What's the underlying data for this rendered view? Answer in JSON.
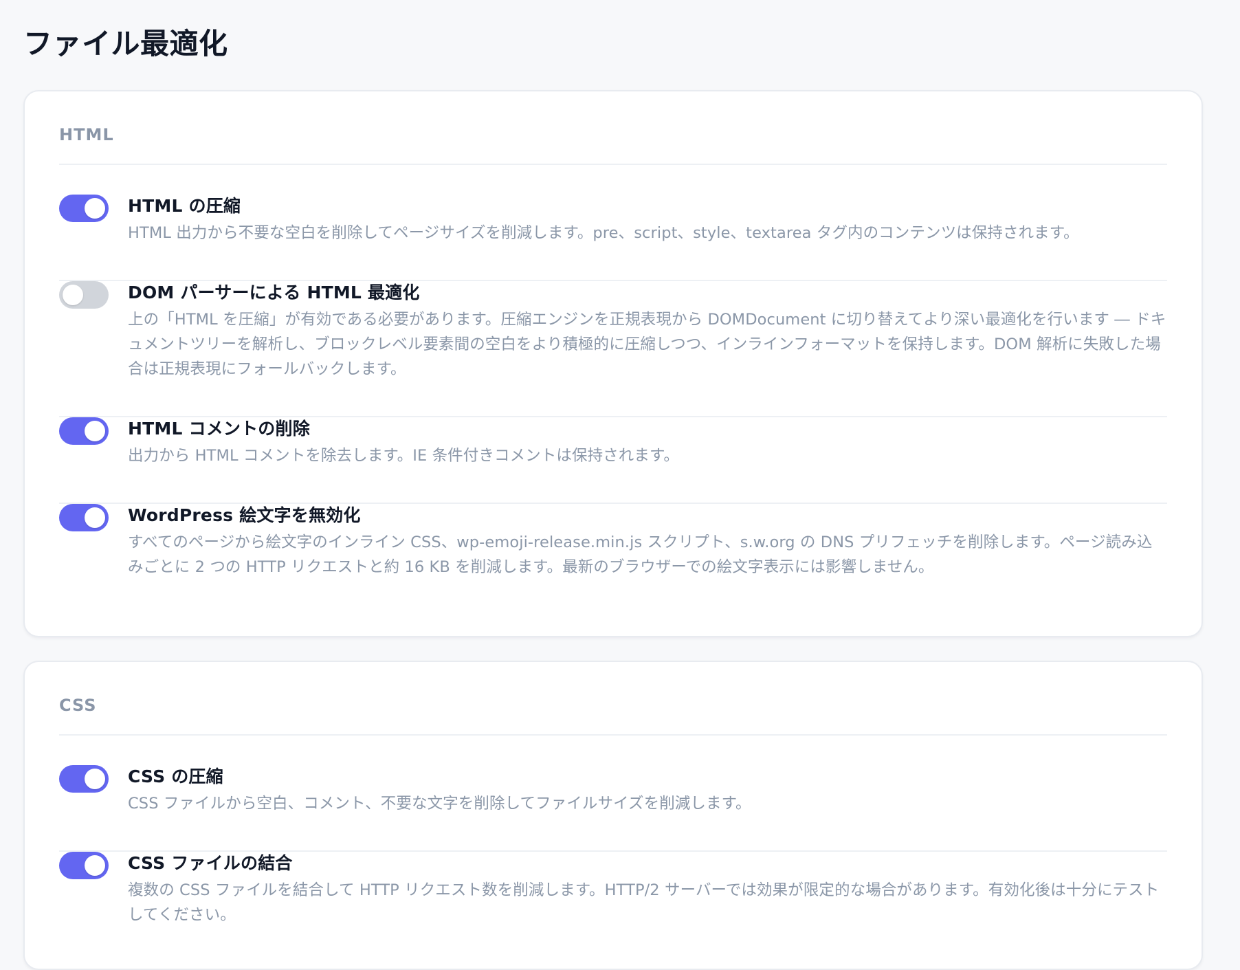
{
  "page": {
    "title": "ファイル最適化"
  },
  "sections": [
    {
      "title": "HTML",
      "settings": [
        {
          "label": "HTML の圧縮",
          "description": "HTML 出力から不要な空白を削除してページサイズを削減します。pre、script、style、textarea タグ内のコンテンツは保持されます。",
          "enabled": true
        },
        {
          "label": "DOM パーサーによる HTML 最適化",
          "description": "上の「HTML を圧縮」が有効である必要があります。圧縮エンジンを正規表現から DOMDocument に切り替えてより深い最適化を行います ― ドキュメントツリーを解析し、ブロックレベル要素間の空白をより積極的に圧縮しつつ、インラインフォーマットを保持します。DOM 解析に失敗した場合は正規表現にフォールバックします。",
          "enabled": false
        },
        {
          "label": "HTML コメントの削除",
          "description": "出力から HTML コメントを除去します。IE 条件付きコメントは保持されます。",
          "enabled": true
        },
        {
          "label": "WordPress 絵文字を無効化",
          "description": "すべてのページから絵文字のインライン CSS、wp-emoji-release.min.js スクリプト、s.w.org の DNS プリフェッチを削除します。ページ読み込みごとに 2 つの HTTP リクエストと約 16 KB を削減します。最新のブラウザーでの絵文字表示には影響しません。",
          "enabled": true
        }
      ]
    },
    {
      "title": "CSS",
      "settings": [
        {
          "label": "CSS の圧縮",
          "description": "CSS ファイルから空白、コメント、不要な文字を削除してファイルサイズを削減します。",
          "enabled": true
        },
        {
          "label": "CSS ファイルの結合",
          "description": "複数の CSS ファイルを結合して HTTP リクエスト数を削減します。HTTP/2 サーバーでは効果が限定的な場合があります。有効化後は十分にテストしてください。",
          "enabled": true
        }
      ]
    }
  ],
  "colors": {
    "accent": "#6366f1",
    "toggle_off": "#d1d5db",
    "background": "#f7f8fa",
    "heading": "#111827",
    "muted_text": "#8b97a8",
    "section_title": "#8a96a8"
  }
}
